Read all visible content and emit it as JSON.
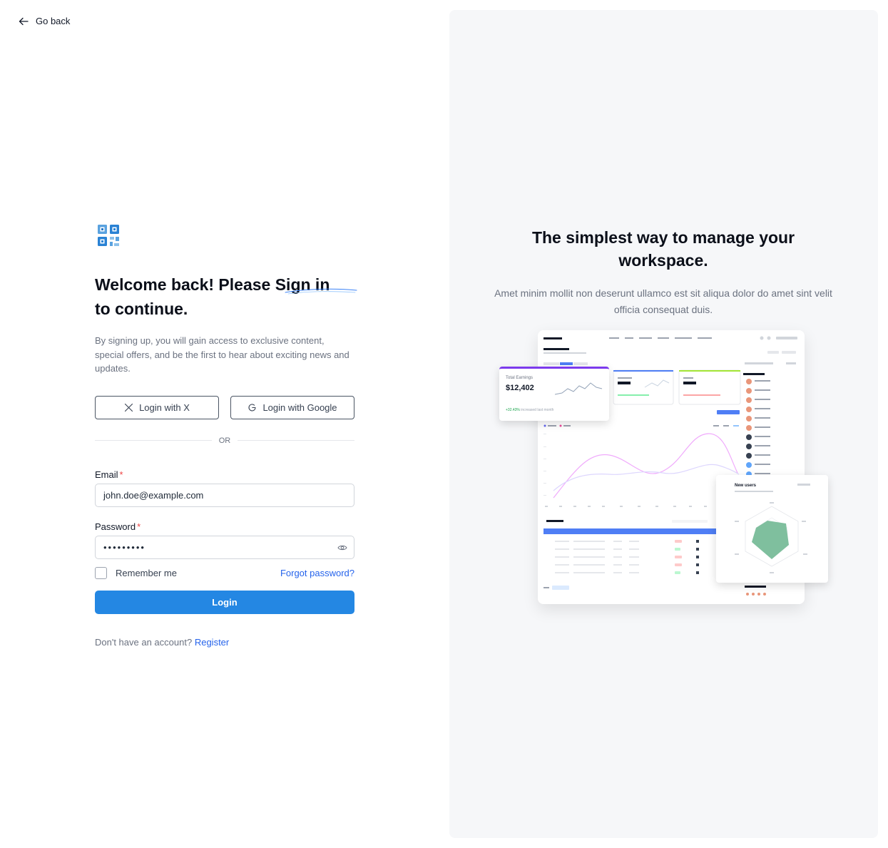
{
  "nav": {
    "back_label": "Go back"
  },
  "form": {
    "title_line1": "Welcome back! Please Sign in",
    "title_line2": "to continue.",
    "subtitle": "By signing up, you will gain access to exclusive content, special offers, and be the first to hear about exciting news and updates.",
    "login_x": "Login with X",
    "login_google": "Login with Google",
    "or": "OR",
    "email_label": "Email",
    "required_mark": "*",
    "email_value": "john.doe@example.com",
    "password_label": "Password",
    "password_value": "•••••••••",
    "remember": "Remember me",
    "forgot": "Forgot password?",
    "login_button": "Login",
    "no_account": "Don't have an account?",
    "register": "Register"
  },
  "panel": {
    "title": "The simplest way to manage your workspace.",
    "subtitle": "Amet minim mollit non deserunt ullamco est sit aliqua dolor do amet sint velit officia consequat duis.",
    "preview": {
      "earnings_label": "Total Earnings",
      "earnings_value": "$12,402",
      "earnings_growth": "+32.43%",
      "earnings_note": "increased last month",
      "new_users_label": "New users"
    }
  },
  "colors": {
    "primary": "#2487e3",
    "link": "#2563eb",
    "required": "#ef4444",
    "panel_bg": "#f6f7f9"
  }
}
